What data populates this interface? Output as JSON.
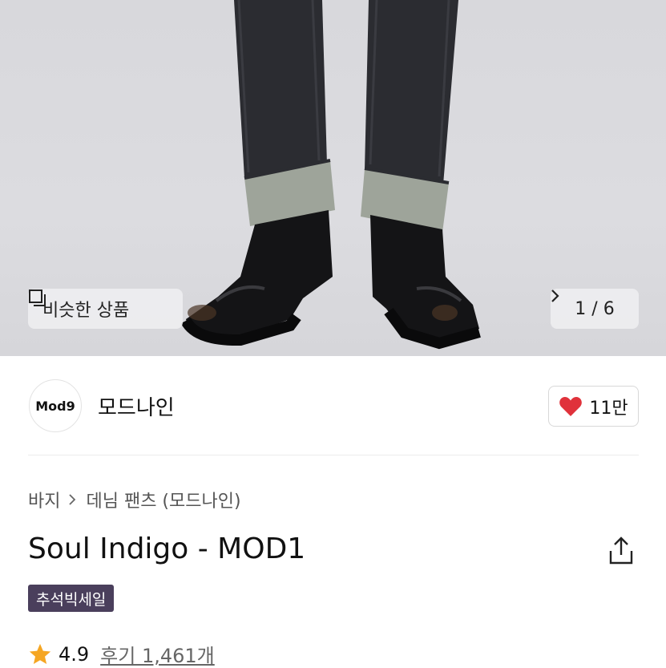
{
  "hero": {
    "similar_label": "비슷한 상품",
    "pager_text": "1 / 6"
  },
  "brand": {
    "logo_text": "Mod9",
    "name": "모드나인",
    "likes": "11만"
  },
  "product": {
    "breadcrumb": [
      "바지",
      "데님 팬츠 (모드나인)"
    ],
    "title": "Soul Indigo - MOD1",
    "badge": "추석빅세일",
    "rating": "4.9",
    "reviews": "후기 1,461개"
  },
  "colors": {
    "badge_bg": "#4a3f5c",
    "heart": "#e0323b",
    "star": "#f5a623"
  }
}
